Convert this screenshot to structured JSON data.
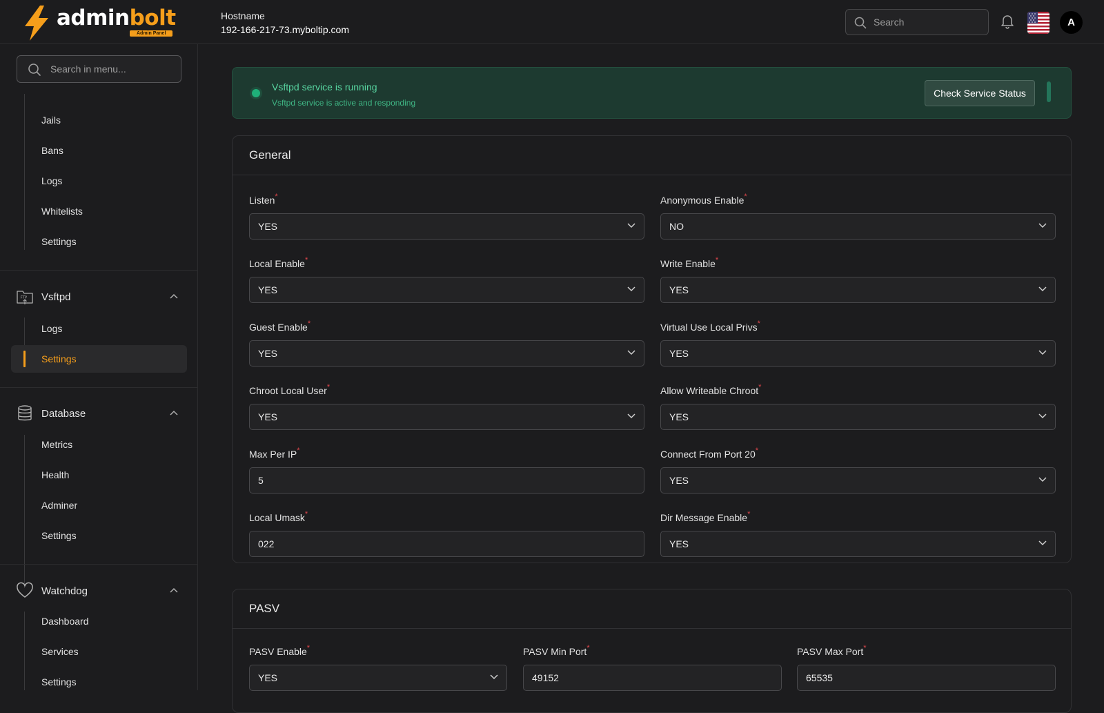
{
  "header": {
    "logo_text_a": "admin",
    "logo_text_b": "bolt",
    "logo_badge": "Admin Panel",
    "hostname_label": "Hostname",
    "hostname_value": "192-166-217-73.myboltip.com",
    "search_placeholder": "Search",
    "avatar_initial": "A"
  },
  "sidebar": {
    "search_placeholder": "Search in menu...",
    "groups": [
      {
        "items": [
          "Jails",
          "Bans",
          "Logs",
          "Whitelists",
          "Settings"
        ]
      },
      {
        "title": "Vsftpd",
        "icon": "ftp-folder-icon",
        "items": [
          "Logs",
          "Settings"
        ],
        "active": "Settings"
      },
      {
        "title": "Database",
        "icon": "database-icon",
        "items": [
          "Metrics",
          "Health",
          "Adminer",
          "Settings"
        ]
      },
      {
        "title": "Watchdog",
        "icon": "heart-icon",
        "items": [
          "Dashboard",
          "Services",
          "Settings"
        ]
      }
    ]
  },
  "banner": {
    "title": "Vsftpd service is running",
    "subtitle": "Vsftpd service is active and responding",
    "button": "Check Service Status",
    "status_color": "#1fb079"
  },
  "general": {
    "title": "General",
    "fields": [
      {
        "label": "Listen",
        "value": "YES",
        "type": "select"
      },
      {
        "label": "Anonymous Enable",
        "value": "NO",
        "type": "select"
      },
      {
        "label": "Local Enable",
        "value": "YES",
        "type": "select"
      },
      {
        "label": "Write Enable",
        "value": "YES",
        "type": "select"
      },
      {
        "label": "Guest Enable",
        "value": "YES",
        "type": "select"
      },
      {
        "label": "Virtual Use Local Privs",
        "value": "YES",
        "type": "select"
      },
      {
        "label": "Chroot Local User",
        "value": "YES",
        "type": "select"
      },
      {
        "label": "Allow Writeable Chroot",
        "value": "YES",
        "type": "select"
      },
      {
        "label": "Max Per IP",
        "value": "5",
        "type": "input"
      },
      {
        "label": "Connect From Port 20",
        "value": "YES",
        "type": "select"
      },
      {
        "label": "Local Umask",
        "value": "022",
        "type": "input"
      },
      {
        "label": "Dir Message Enable",
        "value": "YES",
        "type": "select"
      }
    ]
  },
  "pasv": {
    "title": "PASV",
    "fields": [
      {
        "label": "PASV Enable",
        "value": "YES",
        "type": "select"
      },
      {
        "label": "PASV Min Port",
        "value": "49152",
        "type": "input"
      },
      {
        "label": "PASV Max Port",
        "value": "65535",
        "type": "input"
      }
    ]
  },
  "required_marker": "*",
  "accent_color": "#f59e1b"
}
